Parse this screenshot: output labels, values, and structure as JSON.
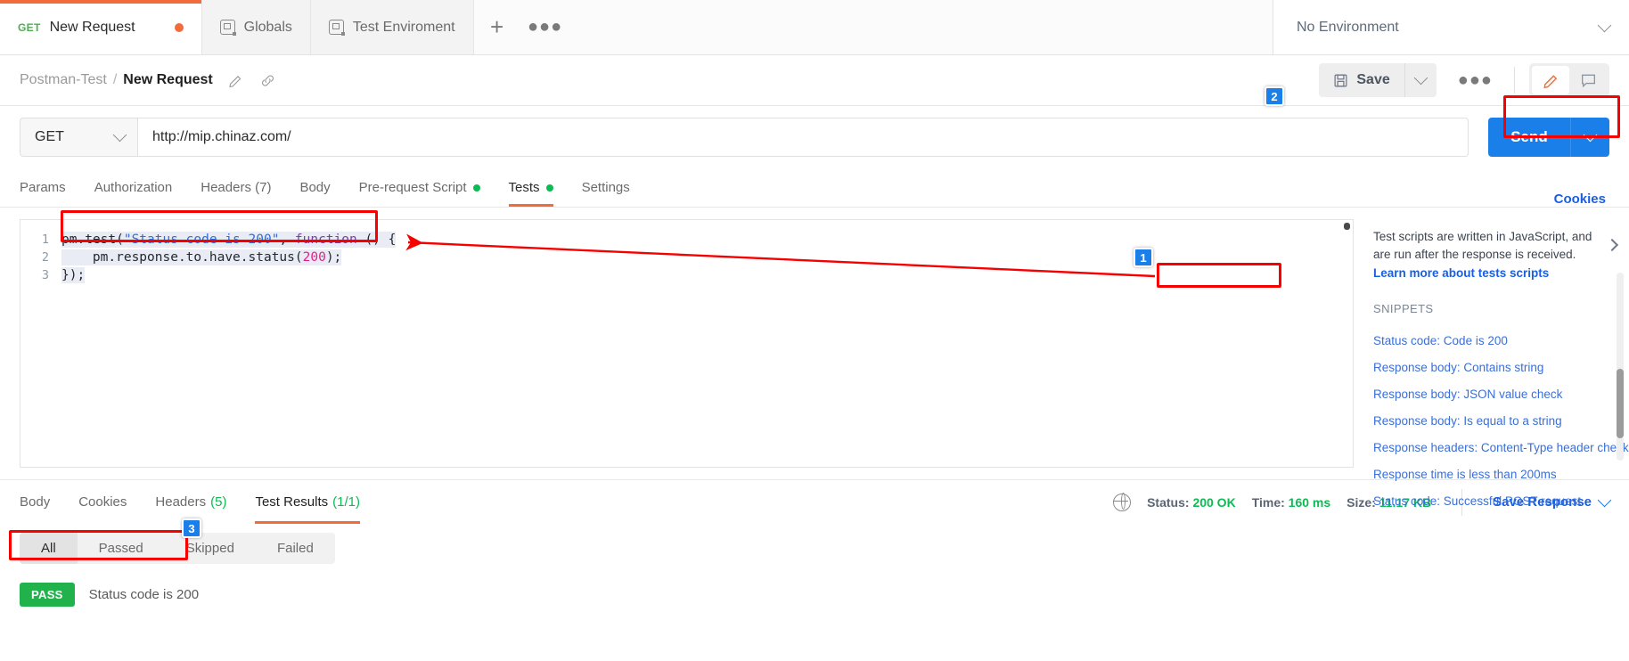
{
  "tabbar": {
    "request_tab": {
      "method": "GET",
      "name": "New Request",
      "unsaved": true
    },
    "env_tabs": [
      {
        "label": "Globals"
      },
      {
        "label": "Test Enviroment"
      }
    ],
    "add_label": "+",
    "more_label": "●●●",
    "environment": {
      "selected": "No Environment"
    }
  },
  "breadcrumb": {
    "collection": "Postman-Test",
    "separator": "/",
    "request": "New Request"
  },
  "toolbar": {
    "save_label": "Save",
    "more_label": "●●●"
  },
  "url_bar": {
    "method": "GET",
    "url": "http://mip.chinaz.com/",
    "send_label": "Send"
  },
  "request_tabs": [
    {
      "label": "Params",
      "dot": false,
      "active": false
    },
    {
      "label": "Authorization",
      "dot": false,
      "active": false
    },
    {
      "label": "Headers (7)",
      "dot": false,
      "active": false
    },
    {
      "label": "Body",
      "dot": false,
      "active": false
    },
    {
      "label": "Pre-request Script",
      "dot": true,
      "active": false
    },
    {
      "label": "Tests",
      "dot": true,
      "active": true
    },
    {
      "label": "Settings",
      "dot": false,
      "active": false
    }
  ],
  "cookies_link": "Cookies",
  "editor": {
    "lines": [
      {
        "num": "1",
        "parts": [
          {
            "t": "pm.test(",
            "c": "pun"
          },
          {
            "t": "\"Status code is 200\"",
            "c": "str"
          },
          {
            "t": ", ",
            "c": "pun"
          },
          {
            "t": "function",
            "c": "kw"
          },
          {
            "t": " () {",
            "c": "pun"
          }
        ]
      },
      {
        "num": "2",
        "parts": [
          {
            "t": "    pm.response.to.have.status(",
            "c": "pun"
          },
          {
            "t": "200",
            "c": "num"
          },
          {
            "t": ");",
            "c": "pun"
          }
        ]
      },
      {
        "num": "3",
        "parts": [
          {
            "t": "});",
            "c": "pun"
          }
        ]
      }
    ]
  },
  "snippets_panel": {
    "description": "Test scripts are written in JavaScript, and are run after the response is received.",
    "learn_more": "Learn more about tests scripts",
    "section_title": "SNIPPETS",
    "items": [
      "Status code: Code is 200",
      "Response body: Contains string",
      "Response body: JSON value check",
      "Response body: Is equal to a string",
      "Response headers: Content-Type header check",
      "Response time is less than 200ms",
      "Status code: Successful POST request"
    ]
  },
  "response_tabs": [
    {
      "label": "Body",
      "count": "",
      "active": false
    },
    {
      "label": "Cookies",
      "count": "",
      "active": false
    },
    {
      "label": "Headers",
      "count": "(5)",
      "active": false
    },
    {
      "label": "Test Results",
      "count": "(1/1)",
      "active": true
    }
  ],
  "response_meta": {
    "status_label": "Status:",
    "status_value": "200 OK",
    "time_label": "Time:",
    "time_value": "160 ms",
    "size_label": "Size:",
    "size_value": "11.17 KB",
    "save_response": "Save Response"
  },
  "result_filters": [
    {
      "label": "All",
      "active": true
    },
    {
      "label": "Passed",
      "active": false
    },
    {
      "label": "Skipped",
      "active": false
    },
    {
      "label": "Failed",
      "active": false
    }
  ],
  "test_results": [
    {
      "status": "PASS",
      "name": "Status code is 200"
    }
  ],
  "annotations": [
    {
      "id": "1",
      "label": "1"
    },
    {
      "id": "2",
      "label": "2"
    },
    {
      "id": "3",
      "label": "3"
    }
  ],
  "colors": {
    "accent_orange": "#f26b3a",
    "send_blue": "#1a7fe8",
    "pass_green": "#22b24c",
    "annotation_red": "#f70000",
    "link_blue": "#1a5fe0"
  }
}
